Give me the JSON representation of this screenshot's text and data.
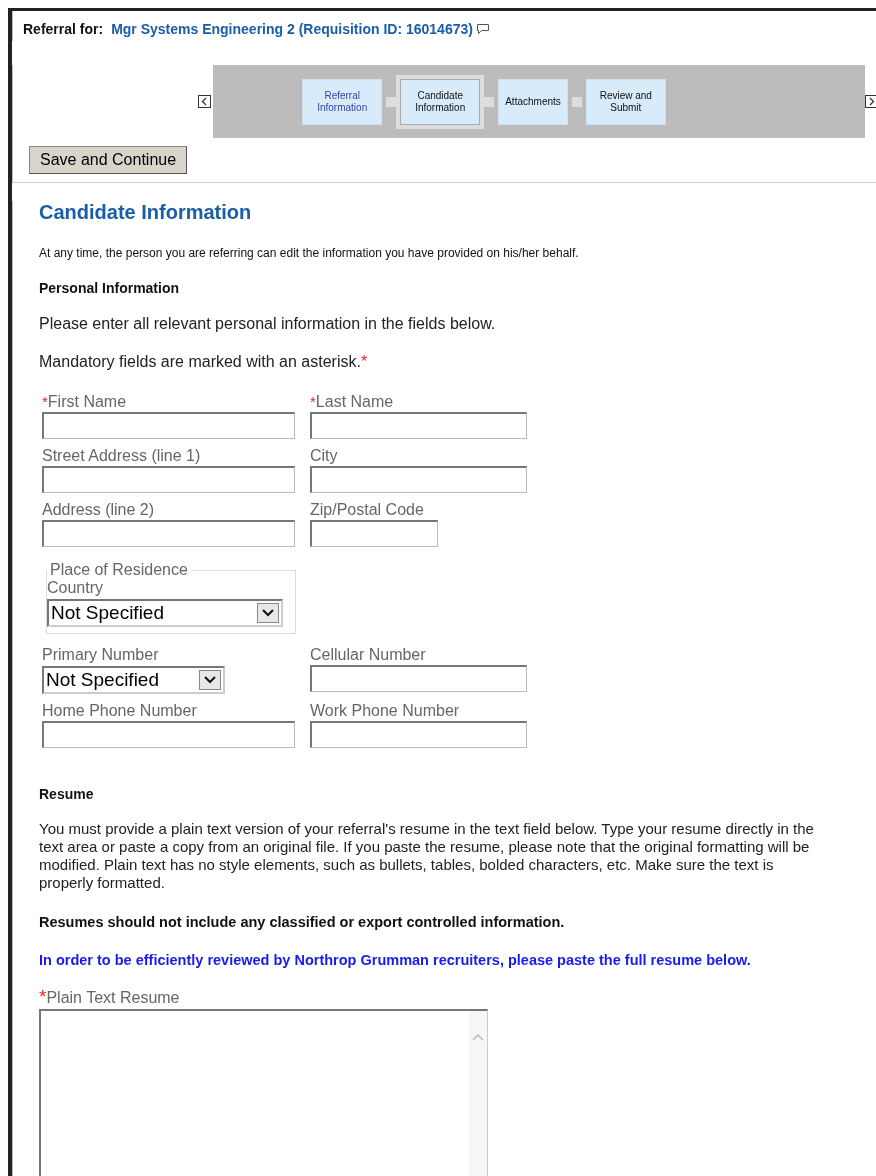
{
  "header": {
    "label": "Referral for:",
    "title": "Mgr Systems Engineering 2 (Requisition ID: 16014673)"
  },
  "steps": [
    {
      "label": "Referral Information",
      "selected": false
    },
    {
      "label": "Candidate Information",
      "selected": true
    },
    {
      "label": "Attachments",
      "selected": false
    },
    {
      "label": "Review and Submit",
      "selected": false
    }
  ],
  "save_button": "Save and Continue",
  "page_title": "Candidate Information",
  "intro": "At any time, the person you are referring can edit the information you have provided on his/her behalf.",
  "personal": {
    "heading": "Personal Information",
    "instruction": "Please enter all relevant personal information in the fields below.",
    "mandatory_note": "Mandatory fields are marked with an asterisk.",
    "mandatory_mark": "*"
  },
  "field_rows": [
    [
      {
        "kind": "text",
        "label": "First Name",
        "required_mark": "*"
      },
      {
        "kind": "text",
        "label": "Last Name",
        "required_mark": "*"
      }
    ],
    [
      {
        "kind": "text",
        "label": "Street Address (line 1)"
      },
      {
        "kind": "text",
        "label": "City"
      }
    ],
    [
      {
        "kind": "text",
        "label": "Address (line 2)"
      },
      {
        "kind": "short_text",
        "label": "Zip/Postal Code"
      }
    ],
    [
      {
        "kind": "fieldset",
        "legend": "Place of Residence",
        "label": "Country",
        "value": "Not Specified"
      }
    ],
    [
      {
        "kind": "select",
        "label": "Primary Number",
        "value": "Not Specified"
      },
      {
        "kind": "text",
        "label": "Cellular Number"
      }
    ],
    [
      {
        "kind": "text",
        "label": "Home Phone Number"
      },
      {
        "kind": "text",
        "label": "Work Phone Number"
      }
    ]
  ],
  "resume": {
    "heading": "Resume",
    "instructions": "You must provide a plain text version of your referral's resume in the text field below. Type your resume directly in the text area or paste a copy from an original file. If you paste the resume, please note that the original formatting will be modified. Plain text has no style elements, such as bullets, tables, bolded characters, etc. Make sure the text is properly formatted.",
    "warning": "Resumes should not include any classified or export controlled information.",
    "notice": "In order to be efficiently reviewed by Northrop Grumman recruiters, please paste the full resume below.",
    "field_label": "Plain Text Resume",
    "required_mark": "*"
  }
}
